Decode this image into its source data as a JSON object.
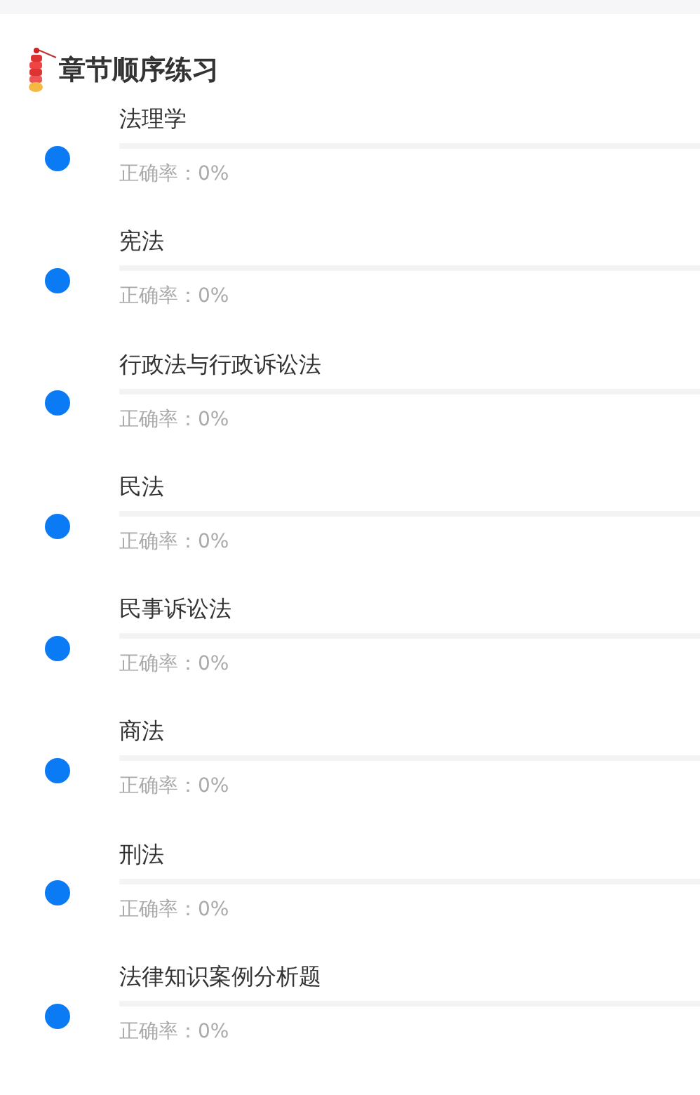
{
  "section": {
    "title": "章节顺序练习"
  },
  "chapters": [
    {
      "name": "法理学",
      "level": 0,
      "accuracy": "正确率：0%"
    },
    {
      "name": "宪法",
      "level": 0,
      "accuracy": "正确率：0%"
    },
    {
      "name": "行政法与行政诉讼法",
      "level": 0,
      "accuracy": "正确率：0%"
    },
    {
      "name": "民法",
      "level": 0,
      "accuracy": "正确率：0%"
    },
    {
      "name": "民事诉讼法",
      "level": 0,
      "accuracy": "正确率：0%"
    },
    {
      "name": "商法",
      "level": 0,
      "accuracy": "正确率：0%"
    },
    {
      "name": "刑法",
      "level": 0,
      "accuracy": "正确率：0%"
    },
    {
      "name": "法律知识案例分析题",
      "level": 0,
      "accuracy": "正确率：0%"
    }
  ]
}
